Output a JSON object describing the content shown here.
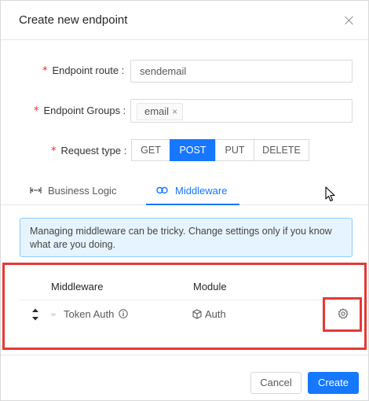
{
  "dialog": {
    "title": "Create new endpoint"
  },
  "form": {
    "required_mark": "*",
    "route_label": "Endpoint route :",
    "route_value": "sendemail",
    "groups_label": "Endpoint Groups :",
    "groups_tags": [
      "email"
    ],
    "tag_remove": "×",
    "request_type_label": "Request type :",
    "request_types": [
      "GET",
      "POST",
      "PUT",
      "DELETE"
    ],
    "request_type_selected": "POST"
  },
  "tabs": [
    {
      "label": "Business Logic",
      "icon": "code-icon",
      "active": false
    },
    {
      "label": "Middleware",
      "icon": "link-icon",
      "active": true
    }
  ],
  "alert": {
    "text": "Managing middleware can be tricky. Change settings only if you know what are you doing."
  },
  "middleware_table": {
    "headers": [
      "Middleware",
      "Module"
    ],
    "rows": [
      {
        "middleware": "Token Auth",
        "module": "Auth"
      }
    ]
  },
  "footer": {
    "cancel_label": "Cancel",
    "create_label": "Create"
  },
  "colors": {
    "primary": "#1677ff",
    "alert_bg": "#e6f4ff",
    "alert_border": "#91caff",
    "highlight": "#e53935",
    "required": "#f5222d"
  }
}
